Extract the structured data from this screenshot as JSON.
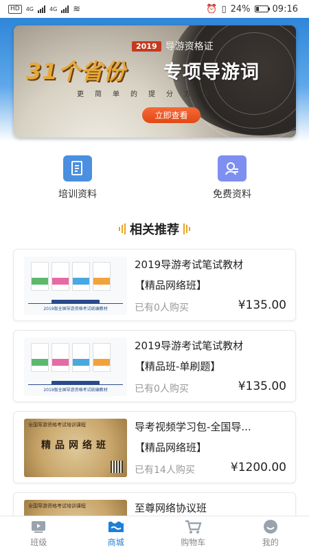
{
  "status_bar": {
    "network_badge": "HD",
    "signal1": "4G",
    "signal2": "4G",
    "battery": "24%",
    "battery_level": 0.24,
    "time": "09:16"
  },
  "banner": {
    "tag_year": "2019",
    "tag_text": "导游资格证",
    "title_left": "31个省份",
    "title_right": "专项导游词",
    "slogan": "更简单的提分方法",
    "cta": "立即查看"
  },
  "quick_entries": [
    {
      "label": "培训资料",
      "icon": "document-icon",
      "color": "#4a8fe0"
    },
    {
      "label": "免费资料",
      "icon": "user-search-icon",
      "color": "#6b7fe6"
    }
  ],
  "section": {
    "title": "相关推荐"
  },
  "products": [
    {
      "title": "2019导游考试笔试教材",
      "subtitle": "【精品网络班】",
      "sold": "已有0人购买",
      "price": "¥135.00",
      "thumb": "books",
      "thumb_caption": "2019版全国导游资格考试统编教材"
    },
    {
      "title": "2019导游考试笔试教材",
      "subtitle": "【精品班-单刷题】",
      "sold": "已有0人购买",
      "price": "¥135.00",
      "thumb": "books",
      "thumb_caption": "2019版全国导游资格考试统编教材"
    },
    {
      "title": "导考视频学习包-全国导...",
      "subtitle": "【精品网络班】",
      "sold": "已有14人购买",
      "price": "¥1200.00",
      "thumb": "paper",
      "thumb_top": "全国导游资格考试培训课程",
      "thumb_title": "精品网络班"
    },
    {
      "title": "至尊网络协议班",
      "subtitle": "",
      "sold": "",
      "price": "",
      "thumb": "paper",
      "thumb_top": "全国导游资格考试培训课程",
      "thumb_title": ""
    }
  ],
  "tabbar": [
    {
      "label": "班级",
      "icon": "play-screen-icon",
      "active": false
    },
    {
      "label": "商城",
      "icon": "store-icon",
      "active": true
    },
    {
      "label": "购物车",
      "icon": "cart-icon",
      "active": false
    },
    {
      "label": "我的",
      "icon": "smiley-profile-icon",
      "active": false
    }
  ],
  "colors": {
    "accent": "#1e7fd6",
    "cta": "#e34712",
    "header": "#2f86d8"
  }
}
